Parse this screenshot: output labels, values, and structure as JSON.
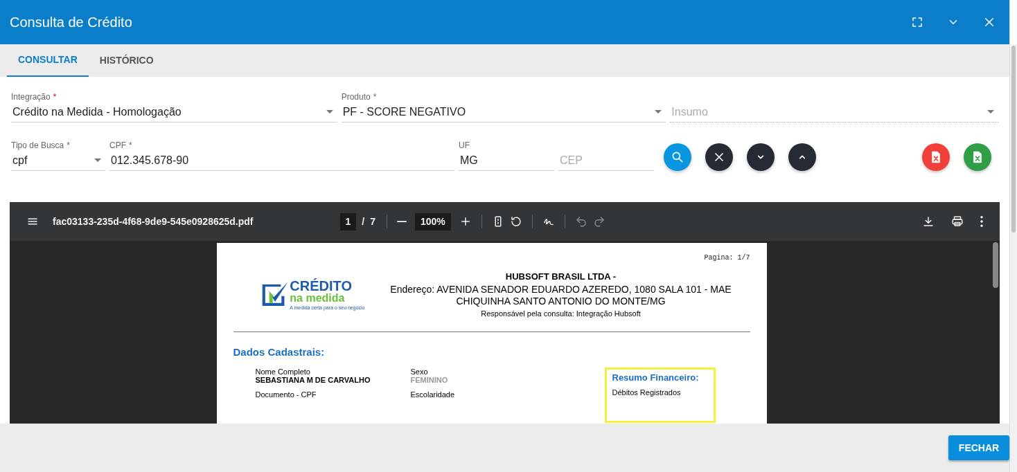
{
  "window": {
    "title": "Consulta de Crédito"
  },
  "tabs": [
    {
      "label": "CONSULTAR",
      "selected": true
    },
    {
      "label": "HISTÓRICO",
      "selected": false
    }
  ],
  "form_rows": [
    [
      {
        "kind": "select",
        "label": "Integração",
        "required_mark": "*",
        "error": true,
        "value": "Crédito na Medida - Homologação",
        "disabled": false
      },
      {
        "kind": "select",
        "label": "Produto",
        "required_mark": "*",
        "error": false,
        "value": "PF - SCORE NEGATIVO",
        "disabled": false
      },
      {
        "kind": "select",
        "placeholder": "Insumo",
        "disabled": true
      }
    ],
    [
      {
        "kind": "select",
        "label": "Tipo de Busca",
        "required_mark": "*",
        "error": false,
        "value": "cpf",
        "disabled": false
      },
      {
        "kind": "input",
        "label": "CPF",
        "required_mark": "*",
        "error": false,
        "value": "012.345.678-90",
        "disabled": false
      },
      {
        "kind": "input",
        "label": "UF",
        "value": "MG",
        "disabled": false
      },
      {
        "kind": "input",
        "placeholder": "CEP",
        "disabled": false
      }
    ]
  ],
  "pdf_viewer": {
    "filename": "fac03133-235d-4f68-9de9-545e0928625d.pdf",
    "page_current": "1",
    "page_separator": "/",
    "page_total": "7",
    "zoom": "100%",
    "document": {
      "page_label": "Pagina: 1/7",
      "logo_title": "CRÉDITO",
      "logo_subtitle": "na medida",
      "logo_tagline": "A medida certa para o seu negócio",
      "company": "HUBSOFT BRASIL LTDA -",
      "address": "Endereço: AVENIDA SENADOR EDUARDO AZEREDO, 1080 SALA 101 - MAE CHIQUINHA SANTO ANTONIO DO MONTE/MG",
      "responsible": "Responsável pela consulta: Integração Hubsoft",
      "section_title": "Dados Cadastrais:",
      "fields": [
        {
          "label": "Nome Completo",
          "value": "SEBASTIANA M DE CARVALHO",
          "muted": false
        },
        {
          "label": "Sexo",
          "value": "FEMININO",
          "muted": true
        },
        {
          "label": "Documento - CPF"
        },
        {
          "label": "Escolaridade"
        }
      ],
      "summary": {
        "title": "Resumo Financeiro:",
        "items": [
          "Débitos Registrados"
        ]
      }
    }
  },
  "footer": {
    "close_button": "FECHAR"
  }
}
